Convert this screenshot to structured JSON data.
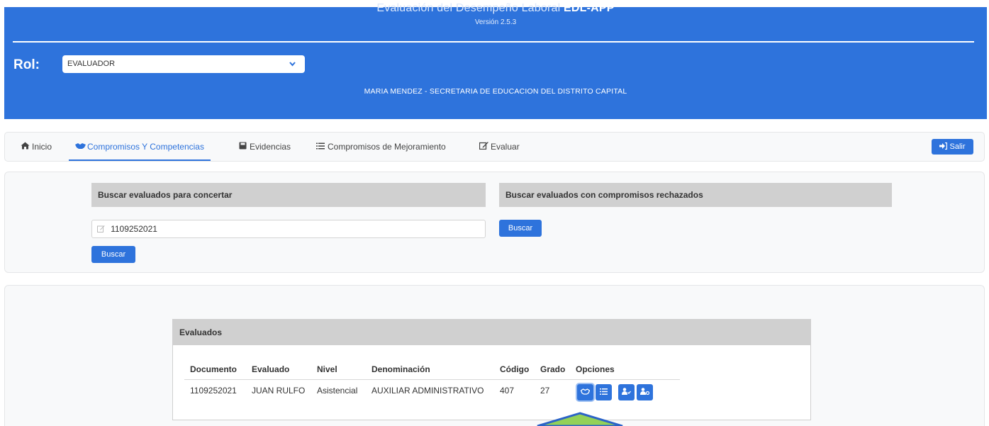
{
  "header": {
    "title_prefix": "Evaluación del Desempeño Laboral",
    "title_bold": "EDL-APP",
    "version": "Versión 2.5.3",
    "rol_label": "Rol:",
    "rol_value": "EVALUADOR",
    "user_line": "MARIA MENDEZ - SECRETARIA DE EDUCACION DEL DISTRITO CAPITAL"
  },
  "nav": {
    "items": [
      {
        "label": "Inicio",
        "icon": "home-icon"
      },
      {
        "label": "Compromisos Y Competencias",
        "icon": "handshake-icon",
        "active": true
      },
      {
        "label": "Evidencias",
        "icon": "save-icon"
      },
      {
        "label": "Compromisos de Mejoramiento",
        "icon": "list-icon"
      },
      {
        "label": "Evaluar",
        "icon": "edit-icon"
      }
    ],
    "logout_label": "Salir"
  },
  "search": {
    "concertar_title": "Buscar evaluados para concertar",
    "rechazados_title": "Buscar evaluados con compromisos rechazados",
    "document_value": "1109252021",
    "buscar_label": "Buscar",
    "buscar_rechazados_label": "Buscar"
  },
  "results": {
    "title": "Evaluados",
    "columns": [
      "Documento",
      "Evaluado",
      "Nivel",
      "Denominación",
      "Código",
      "Grado",
      "Opciones"
    ],
    "rows": [
      {
        "documento": "1109252021",
        "evaluado": "JUAN RULFO",
        "nivel": "Asistencial",
        "denominacion": "AUXILIAR ADMINISTRATIVO",
        "codigo": "407",
        "grado": "27",
        "options": [
          "handshake-icon",
          "list-icon",
          "user-check-icon",
          "user-settings-icon"
        ]
      }
    ]
  },
  "colors": {
    "primary": "#2e73dc",
    "section_header": "#d0d0d0",
    "annotation_arrow": "#93d158"
  }
}
